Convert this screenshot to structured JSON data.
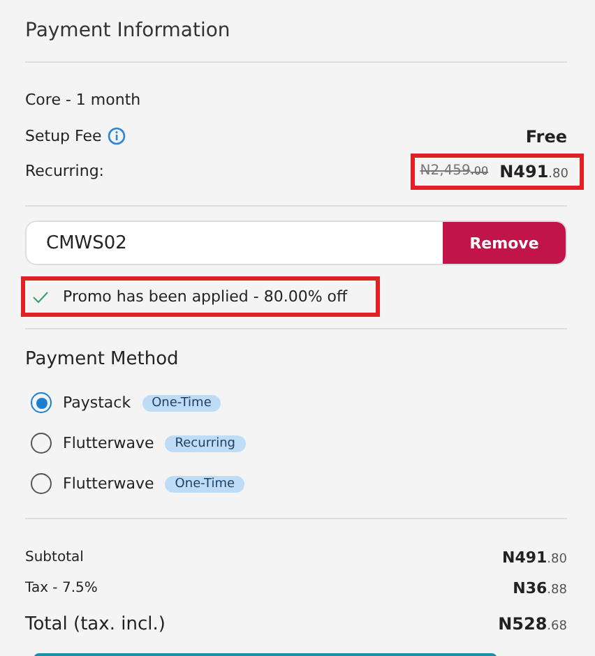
{
  "title": "Payment Information",
  "plan": "Core - 1 month",
  "setup_fee": {
    "label": "Setup Fee",
    "value": "Free"
  },
  "recurring": {
    "label": "Recurring:",
    "old": {
      "whole": "N2,459",
      "cents": ".00"
    },
    "new": {
      "whole": "N491",
      "cents": ".80"
    },
    "highlighted": true
  },
  "promo": {
    "value": "CMWS02",
    "button": "Remove",
    "message": "Promo has been applied - 80.00% off",
    "highlighted": true
  },
  "payment_method": {
    "title": "Payment Method",
    "options": [
      {
        "name": "Paystack",
        "tag": "One-Time",
        "selected": true
      },
      {
        "name": "Flutterwave",
        "tag": "Recurring",
        "selected": false
      },
      {
        "name": "Flutterwave",
        "tag": "One-Time",
        "selected": false
      }
    ]
  },
  "totals": [
    {
      "label": "Subtotal",
      "whole": "N491",
      "cents": ".80",
      "kind": "line"
    },
    {
      "label": "Tax - 7.5%",
      "whole": "N36",
      "cents": ".88",
      "kind": "line"
    },
    {
      "label": "Total (tax. incl.)",
      "whole": "N528",
      "cents": ".68",
      "kind": "total"
    }
  ]
}
